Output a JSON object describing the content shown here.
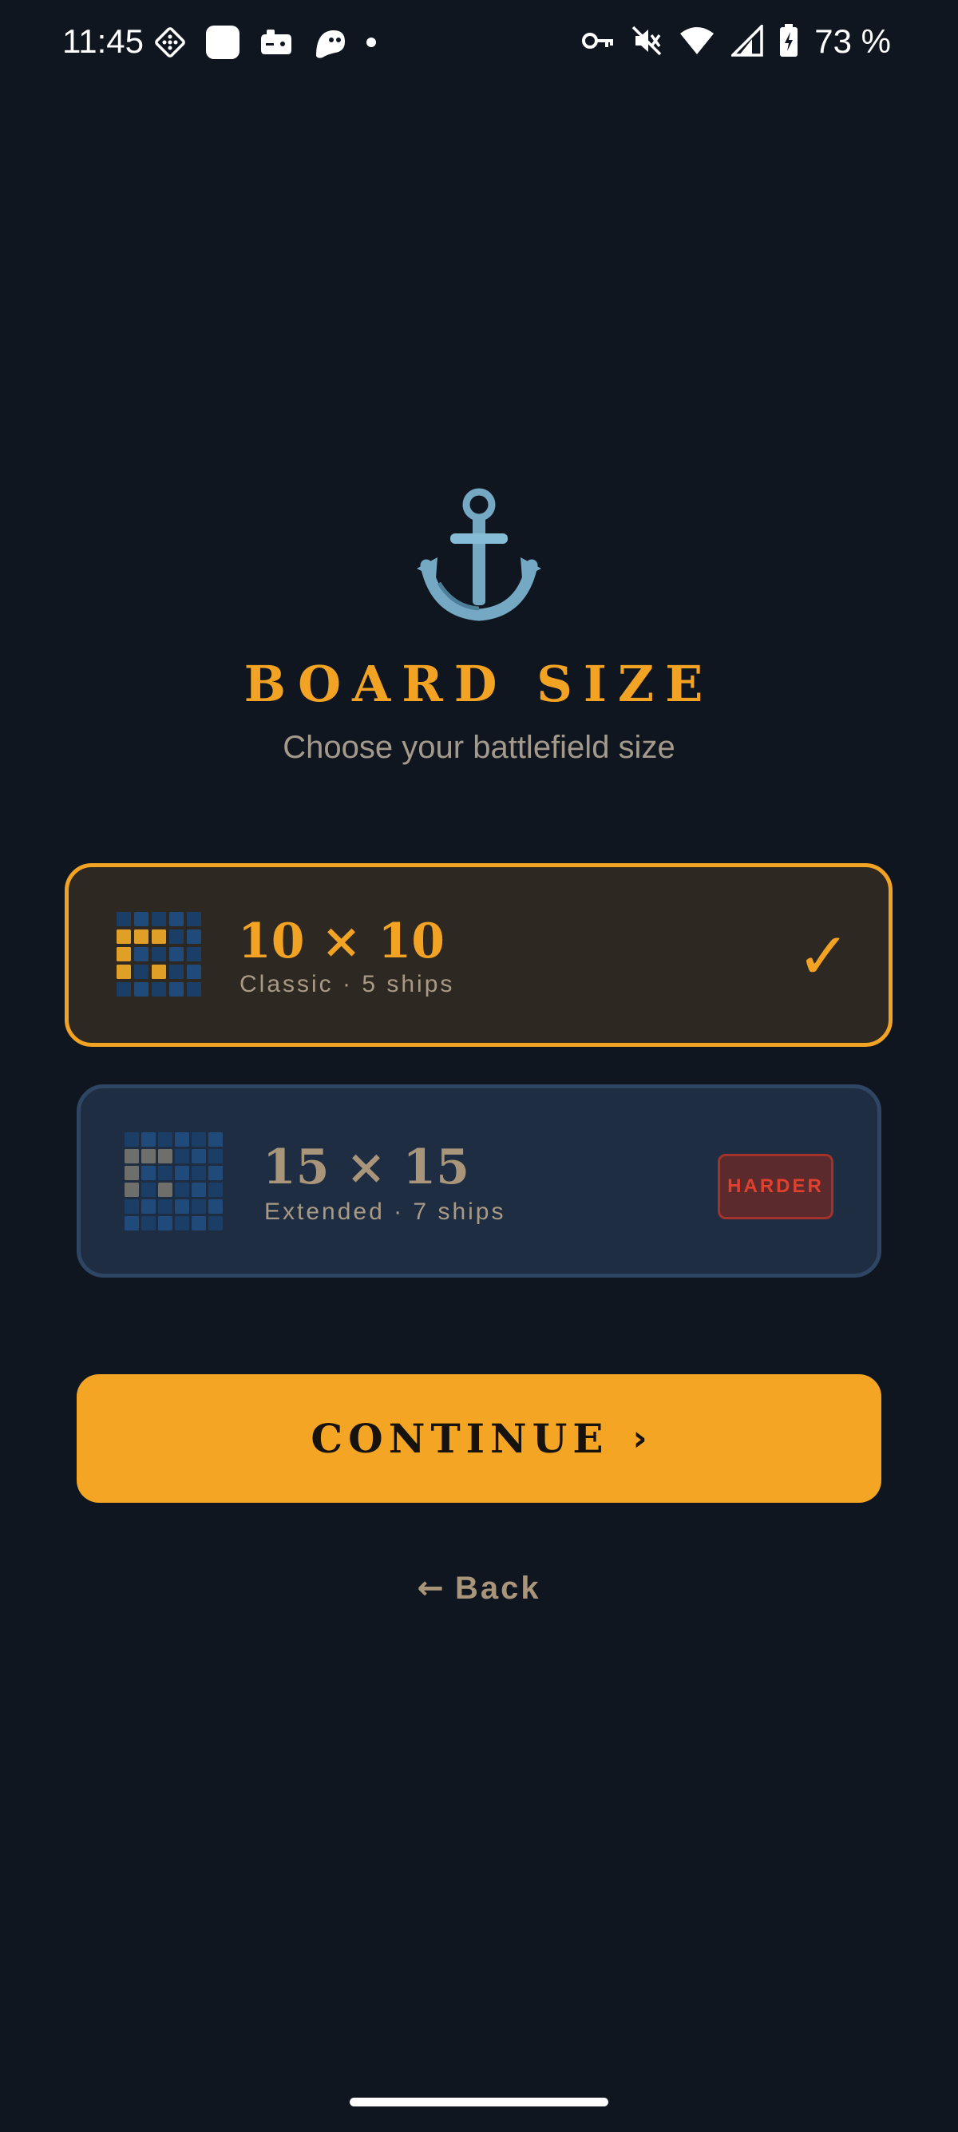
{
  "status_bar": {
    "time": "11:45",
    "battery_text": "73 %",
    "left_icons": [
      "dice-icon",
      "rounded-square-icon",
      "game-controller-icon",
      "ghost-icon",
      "dot-icon"
    ],
    "right_icons": [
      "key-icon",
      "muted-icon",
      "wifi-icon",
      "signal-icon",
      "battery-charging-icon"
    ]
  },
  "header": {
    "icon": "anchor-icon",
    "title": "BOARD SIZE",
    "subtitle": "Choose your battlefield size"
  },
  "options": [
    {
      "title": "10 × 10",
      "subtitle": "Classic · 5 ships",
      "selected": true,
      "indicator": "✓"
    },
    {
      "title": "15 × 15",
      "subtitle": "Extended · 7 ships",
      "selected": false,
      "badge": "HARDER"
    }
  ],
  "actions": {
    "continue_label": "CONTINUE",
    "continue_arrow": "›",
    "back_arrow": "←",
    "back_label": "Back"
  },
  "colors": {
    "background": "#0f1620",
    "accent": "#f2a324",
    "selected_card": "#2d2922",
    "card": "#1f2d42",
    "badge_text": "#e0412f"
  }
}
